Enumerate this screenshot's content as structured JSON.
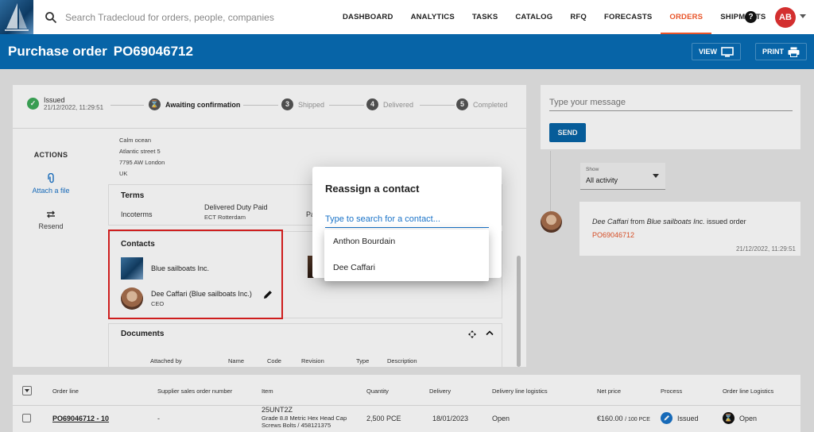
{
  "nav": {
    "search_placeholder": "Search Tradecloud for orders, people, companies",
    "links": [
      "DASHBOARD",
      "ANALYTICS",
      "TASKS",
      "CATALOG",
      "RFQ",
      "FORECASTS",
      "ORDERS",
      "SHIPMENTS"
    ],
    "active_link": "ORDERS",
    "help": "?",
    "avatar_initials": "AB"
  },
  "header": {
    "title": "Purchase order",
    "po_number": "PO69046712",
    "view_label": "VIEW",
    "print_label": "PRINT"
  },
  "stepper": {
    "steps": [
      {
        "label": "Issued",
        "sub": "21/12/2022, 11:29:51",
        "badge": "✓"
      },
      {
        "label": "Awaiting confirmation",
        "badge": "⌛"
      },
      {
        "label": "Shipped",
        "badge": "3"
      },
      {
        "label": "Delivered",
        "badge": "4"
      },
      {
        "label": "Completed",
        "badge": "5"
      }
    ]
  },
  "actions": {
    "title": "ACTIONS",
    "attach": "Attach a file",
    "resend": "Resend"
  },
  "address": [
    "Calm ocean",
    "Atlantic street 5",
    "7795 AW London",
    "UK"
  ],
  "terms": {
    "title": "Terms",
    "incoterms_label": "Incoterms",
    "incoterms_value": "Delivered Duty Paid",
    "incoterms_place": "ECT Rotterdam",
    "partial_label": "Pa"
  },
  "contacts": {
    "title": "Contacts",
    "company": "Blue sailboats Inc.",
    "person": "Dee Caffari (Blue sailboats Inc.)",
    "role": "CEO"
  },
  "documents": {
    "title": "Documents",
    "columns": [
      "Attached by",
      "Name",
      "Code",
      "Revision",
      "Type",
      "Description"
    ]
  },
  "message": {
    "placeholder": "Type your message",
    "send": "SEND"
  },
  "activity": {
    "show_label": "Show",
    "show_value": "All activity",
    "actor": "Dee Caffari",
    "from_word": "from",
    "company": "Blue sailboats Inc.",
    "action": "issued order",
    "order_link": "PO69046712",
    "time": "21/12/2022, 11:29:51"
  },
  "table": {
    "headers": [
      "Order line",
      "Supplier sales order number",
      "Item",
      "Quantity",
      "Delivery",
      "Delivery line logistics",
      "Net price",
      "Process",
      "Order line Logistics"
    ],
    "row": {
      "order_line": "PO69046712 - 10",
      "supplier_so": "-",
      "item_code": "25UNT2Z",
      "item_desc1": "Grade 8.8 Metric Hex Head Cap",
      "item_desc2": "Screws Bolts / 458121375",
      "quantity": "2,500 PCE",
      "delivery": "18/01/2023",
      "delivery_logistics": "Open",
      "net_price": "€160.00",
      "net_price_unit": "/ 100 PCE",
      "process": "Issued",
      "order_logistics": "Open"
    }
  },
  "dialog": {
    "title": "Reassign a contact",
    "placeholder": "Type to search for a contact...",
    "options": [
      "Anthon Bourdain",
      "Dee Caffari"
    ]
  },
  "colors": {
    "brand_blue": "#0764a7",
    "active_orange": "#e8552a",
    "done_green": "#3dab5a",
    "highlight_red": "#e02020"
  }
}
